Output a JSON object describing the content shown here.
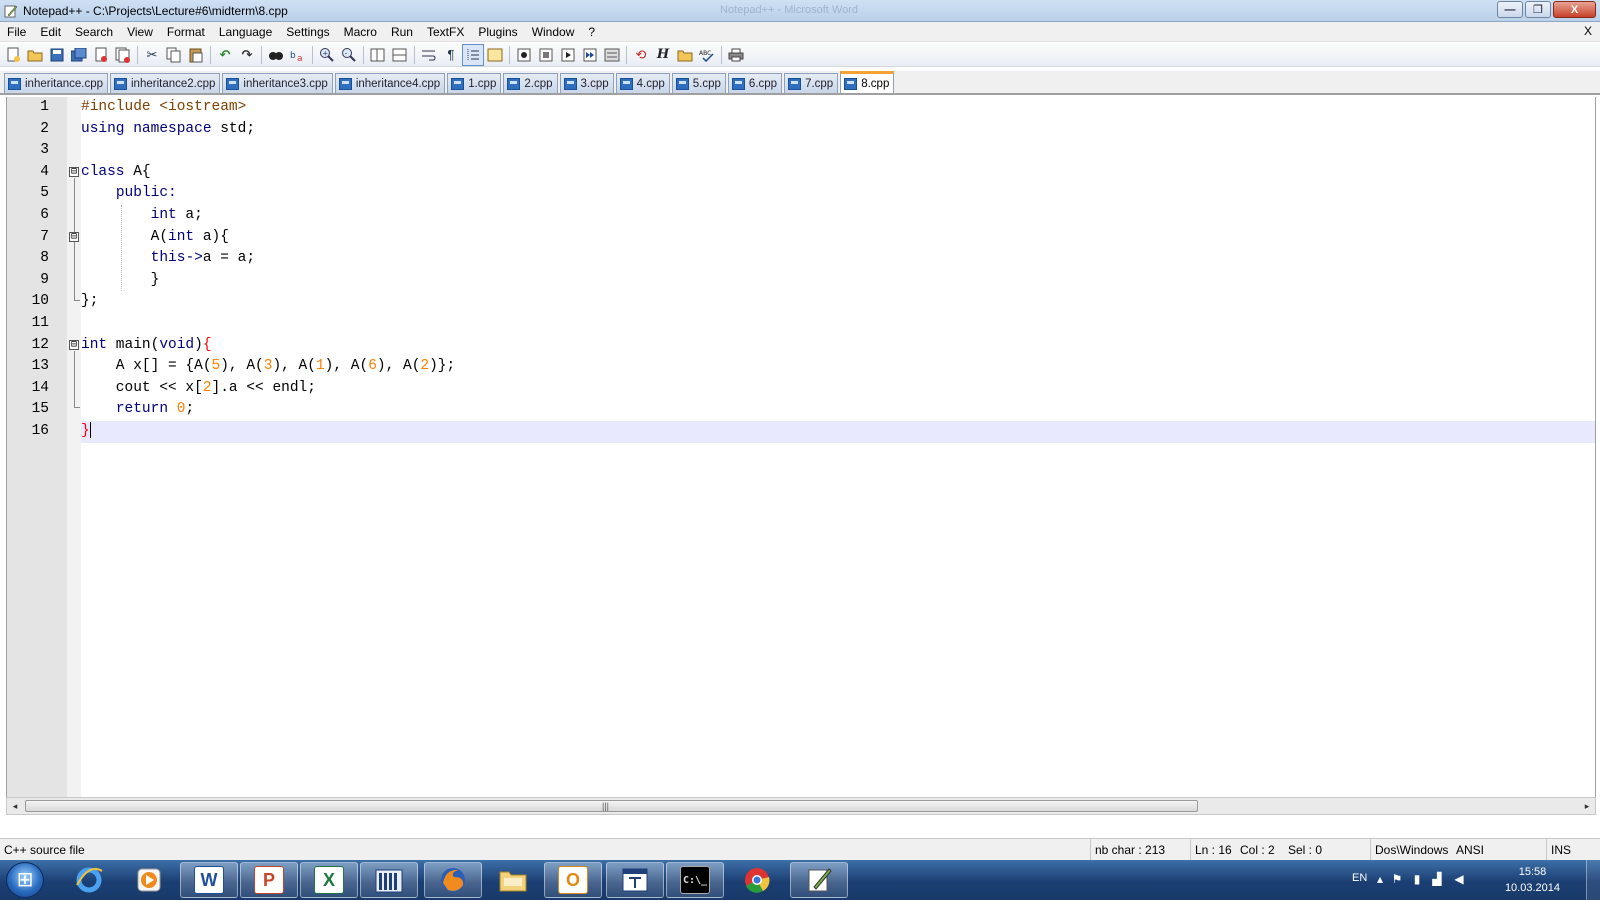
{
  "window": {
    "title": "Notepad++ - C:\\Projects\\Lecture#6\\midterm\\8.cpp",
    "background_title": "Notepad++ - Microsoft Word",
    "minimize_label": "—",
    "maximize_label": "❐",
    "close_label": "X"
  },
  "menu": {
    "items": [
      "File",
      "Edit",
      "Search",
      "View",
      "Format",
      "Language",
      "Settings",
      "Macro",
      "Run",
      "TextFX",
      "Plugins",
      "Window",
      "?"
    ],
    "close_doc": "X"
  },
  "toolbar": {
    "icons": [
      "new-file-icon",
      "open-file-icon",
      "save-icon",
      "save-all-icon",
      "close-icon",
      "close-all-icon",
      "cut-icon",
      "copy-icon",
      "paste-icon",
      "undo-icon",
      "redo-icon",
      "find-icon",
      "replace-icon",
      "zoom-in-icon",
      "zoom-out-icon",
      "sync-v-icon",
      "sync-h-icon",
      "word-wrap-icon",
      "show-all-chars-icon",
      "indent-guide-icon",
      "user-lang-icon",
      "record-macro-icon",
      "stop-macro-icon",
      "play-macro-icon",
      "run-macro-multiple-icon",
      "save-macro-icon",
      "pdf-icon",
      "h-icon",
      "folder-icon",
      "spell-check-icon",
      "print-icon"
    ]
  },
  "tabs": [
    {
      "label": "inheritance.cpp",
      "active": false
    },
    {
      "label": "inheritance2.cpp",
      "active": false
    },
    {
      "label": "inheritance3.cpp",
      "active": false
    },
    {
      "label": "inheritance4.cpp",
      "active": false
    },
    {
      "label": "1.cpp",
      "active": false
    },
    {
      "label": "2.cpp",
      "active": false
    },
    {
      "label": "3.cpp",
      "active": false
    },
    {
      "label": "4.cpp",
      "active": false
    },
    {
      "label": "5.cpp",
      "active": false
    },
    {
      "label": "6.cpp",
      "active": false
    },
    {
      "label": "7.cpp",
      "active": false
    },
    {
      "label": "8.cpp",
      "active": true
    }
  ],
  "editor": {
    "line_numbers": [
      "1",
      "2",
      "3",
      "4",
      "5",
      "6",
      "7",
      "8",
      "9",
      "10",
      "11",
      "12",
      "13",
      "14",
      "15",
      "16"
    ],
    "current_line": 16,
    "fold_markers": [
      "⊟",
      "⊟",
      "⊟"
    ]
  },
  "scrollbar": {
    "left_arrow": "◂",
    "right_arrow": "▸",
    "grip": "|||"
  },
  "status": {
    "file_type": "C++ source file",
    "nb_char": "nb char : 213",
    "ln": "Ln : 16",
    "col": "Col : 2",
    "sel": "Sel : 0",
    "eol": "Dos\\Windows",
    "encoding": "ANSI",
    "mode": "INS"
  },
  "taskbar": {
    "apps": [
      "internet-explorer",
      "media-player",
      "word",
      "powerpoint",
      "excel",
      "library",
      "firefox",
      "file-explorer",
      "outlook",
      "app-window",
      "command-prompt",
      "chrome",
      "notepad-plus-plus"
    ],
    "word_glyph": "W",
    "powerpoint_glyph": "P",
    "excel_glyph": "X",
    "outlook_glyph": "O",
    "cmd_glyph": "C:\\_",
    "language": "EN",
    "time": "15:58",
    "date": "10.03.2014"
  },
  "colors": {
    "keyword": "#000080",
    "number": "#ff8000",
    "current_line_bg": "#e8e8ff",
    "active_tab_accent": "#f4a233",
    "taskbar": "#1b3f73"
  }
}
